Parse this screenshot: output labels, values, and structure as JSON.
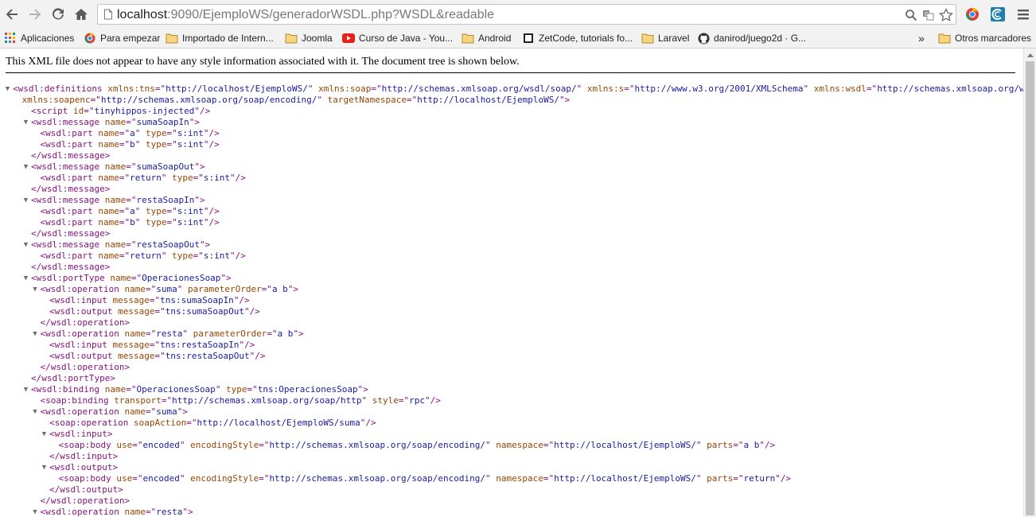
{
  "browser": {
    "url_host": "localhost",
    "url_rest": ":9090/EjemploWS/generadorWSDL.php?WSDL&readable",
    "icons": {
      "back": "back-arrow-icon",
      "forward": "forward-arrow-icon",
      "reload": "reload-icon",
      "home": "home-icon",
      "page": "page-icon",
      "zoom": "magnifier-icon",
      "translate": "translate-icon",
      "star": "bookmark-star-icon",
      "ext1": "chrome-extension-icon",
      "ext2": "extension-icon",
      "menu": "hamburger-menu-icon"
    }
  },
  "bookmarks": {
    "items": [
      {
        "label": "Aplicaciones",
        "icon": "apps-grid-icon"
      },
      {
        "label": "Para empezar",
        "icon": "chrome-logo-icon"
      },
      {
        "label": "Importado de Intern...",
        "icon": "folder-icon"
      },
      {
        "label": "Joomla",
        "icon": "folder-icon"
      },
      {
        "label": "Curso de Java - You...",
        "icon": "youtube-icon"
      },
      {
        "label": "Android",
        "icon": "folder-icon"
      },
      {
        "label": "ZetCode, tutorials fo...",
        "icon": "zetcode-icon"
      },
      {
        "label": "Laravel",
        "icon": "folder-icon"
      },
      {
        "label": "danirod/juego2d · G...",
        "icon": "github-icon"
      }
    ],
    "overflow": "»",
    "other": {
      "label": "Otros marcadores",
      "icon": "folder-icon"
    }
  },
  "content": {
    "notice": "This XML file does not appear to have any style information associated with it. The document tree is shown below.",
    "lines": [
      {
        "t": true,
        "parts": [
          [
            "tag",
            "<wsdl:definitions "
          ],
          [
            "an",
            "xmlns:tns"
          ],
          [
            "tag",
            "=\""
          ],
          [
            "av",
            "http://localhost/EjemploWS/"
          ],
          [
            "tag",
            "\" "
          ],
          [
            "an",
            "xmlns:soap"
          ],
          [
            "tag",
            "=\""
          ],
          [
            "av",
            "http://schemas.xmlsoap.org/wsdl/soap/"
          ],
          [
            "tag",
            "\" "
          ],
          [
            "an",
            "xmlns:s"
          ],
          [
            "tag",
            "=\""
          ],
          [
            "av",
            "http://www.w3.org/2001/XMLSchema"
          ],
          [
            "tag",
            "\" "
          ],
          [
            "an",
            "xmlns:wsdl"
          ],
          [
            "tag",
            "=\""
          ],
          [
            "av",
            "http://schemas.xmlsoap.org/wsdl/"
          ],
          [
            "tag",
            "\""
          ]
        ]
      },
      {
        "d": 1,
        "parts": [
          [
            "an",
            "xmlns:soapenc"
          ],
          [
            "tag",
            "=\""
          ],
          [
            "av",
            "http://schemas.xmlsoap.org/soap/encoding/"
          ],
          [
            "tag",
            "\" "
          ],
          [
            "an",
            "targetNamespace"
          ],
          [
            "tag",
            "=\""
          ],
          [
            "av",
            "http://localhost/EjemploWS/"
          ],
          [
            "tag",
            "\">"
          ]
        ]
      },
      {
        "d": 2,
        "parts": [
          [
            "tag",
            "<script "
          ],
          [
            "an",
            "id"
          ],
          [
            "tag",
            "=\""
          ],
          [
            "av",
            "tinyhippos-injected"
          ],
          [
            "tag",
            "\"/>"
          ]
        ]
      },
      {
        "d": 2,
        "t": true,
        "parts": [
          [
            "tag",
            "<wsdl:message "
          ],
          [
            "an",
            "name"
          ],
          [
            "tag",
            "=\""
          ],
          [
            "av",
            "sumaSoapIn"
          ],
          [
            "tag",
            "\">"
          ]
        ]
      },
      {
        "d": 3,
        "parts": [
          [
            "tag",
            "<wsdl:part "
          ],
          [
            "an",
            "name"
          ],
          [
            "tag",
            "=\""
          ],
          [
            "av",
            "a"
          ],
          [
            "tag",
            "\" "
          ],
          [
            "an",
            "type"
          ],
          [
            "tag",
            "=\""
          ],
          [
            "av",
            "s:int"
          ],
          [
            "tag",
            "\"/>"
          ]
        ]
      },
      {
        "d": 3,
        "parts": [
          [
            "tag",
            "<wsdl:part "
          ],
          [
            "an",
            "name"
          ],
          [
            "tag",
            "=\""
          ],
          [
            "av",
            "b"
          ],
          [
            "tag",
            "\" "
          ],
          [
            "an",
            "type"
          ],
          [
            "tag",
            "=\""
          ],
          [
            "av",
            "s:int"
          ],
          [
            "tag",
            "\"/>"
          ]
        ]
      },
      {
        "d": 2,
        "parts": [
          [
            "tag",
            "</wsdl:message>"
          ]
        ]
      },
      {
        "d": 2,
        "t": true,
        "parts": [
          [
            "tag",
            "<wsdl:message "
          ],
          [
            "an",
            "name"
          ],
          [
            "tag",
            "=\""
          ],
          [
            "av",
            "sumaSoapOut"
          ],
          [
            "tag",
            "\">"
          ]
        ]
      },
      {
        "d": 3,
        "parts": [
          [
            "tag",
            "<wsdl:part "
          ],
          [
            "an",
            "name"
          ],
          [
            "tag",
            "=\""
          ],
          [
            "av",
            "return"
          ],
          [
            "tag",
            "\" "
          ],
          [
            "an",
            "type"
          ],
          [
            "tag",
            "=\""
          ],
          [
            "av",
            "s:int"
          ],
          [
            "tag",
            "\"/>"
          ]
        ]
      },
      {
        "d": 2,
        "parts": [
          [
            "tag",
            "</wsdl:message>"
          ]
        ]
      },
      {
        "d": 2,
        "t": true,
        "parts": [
          [
            "tag",
            "<wsdl:message "
          ],
          [
            "an",
            "name"
          ],
          [
            "tag",
            "=\""
          ],
          [
            "av",
            "restaSoapIn"
          ],
          [
            "tag",
            "\">"
          ]
        ]
      },
      {
        "d": 3,
        "parts": [
          [
            "tag",
            "<wsdl:part "
          ],
          [
            "an",
            "name"
          ],
          [
            "tag",
            "=\""
          ],
          [
            "av",
            "a"
          ],
          [
            "tag",
            "\" "
          ],
          [
            "an",
            "type"
          ],
          [
            "tag",
            "=\""
          ],
          [
            "av",
            "s:int"
          ],
          [
            "tag",
            "\"/>"
          ]
        ]
      },
      {
        "d": 3,
        "parts": [
          [
            "tag",
            "<wsdl:part "
          ],
          [
            "an",
            "name"
          ],
          [
            "tag",
            "=\""
          ],
          [
            "av",
            "b"
          ],
          [
            "tag",
            "\" "
          ],
          [
            "an",
            "type"
          ],
          [
            "tag",
            "=\""
          ],
          [
            "av",
            "s:int"
          ],
          [
            "tag",
            "\"/>"
          ]
        ]
      },
      {
        "d": 2,
        "parts": [
          [
            "tag",
            "</wsdl:message>"
          ]
        ]
      },
      {
        "d": 2,
        "t": true,
        "parts": [
          [
            "tag",
            "<wsdl:message "
          ],
          [
            "an",
            "name"
          ],
          [
            "tag",
            "=\""
          ],
          [
            "av",
            "restaSoapOut"
          ],
          [
            "tag",
            "\">"
          ]
        ]
      },
      {
        "d": 3,
        "parts": [
          [
            "tag",
            "<wsdl:part "
          ],
          [
            "an",
            "name"
          ],
          [
            "tag",
            "=\""
          ],
          [
            "av",
            "return"
          ],
          [
            "tag",
            "\" "
          ],
          [
            "an",
            "type"
          ],
          [
            "tag",
            "=\""
          ],
          [
            "av",
            "s:int"
          ],
          [
            "tag",
            "\"/>"
          ]
        ]
      },
      {
        "d": 2,
        "parts": [
          [
            "tag",
            "</wsdl:message>"
          ]
        ]
      },
      {
        "d": 2,
        "t": true,
        "parts": [
          [
            "tag",
            "<wsdl:portType "
          ],
          [
            "an",
            "name"
          ],
          [
            "tag",
            "=\""
          ],
          [
            "av",
            "OperacionesSoap"
          ],
          [
            "tag",
            "\">"
          ]
        ]
      },
      {
        "d": 3,
        "t": true,
        "parts": [
          [
            "tag",
            "<wsdl:operation "
          ],
          [
            "an",
            "name"
          ],
          [
            "tag",
            "=\""
          ],
          [
            "av",
            "suma"
          ],
          [
            "tag",
            "\" "
          ],
          [
            "an",
            "parameterOrder"
          ],
          [
            "tag",
            "=\""
          ],
          [
            "av",
            "a b"
          ],
          [
            "tag",
            "\">"
          ]
        ]
      },
      {
        "d": 4,
        "parts": [
          [
            "tag",
            "<wsdl:input "
          ],
          [
            "an",
            "message"
          ],
          [
            "tag",
            "=\""
          ],
          [
            "av",
            "tns:sumaSoapIn"
          ],
          [
            "tag",
            "\"/>"
          ]
        ]
      },
      {
        "d": 4,
        "parts": [
          [
            "tag",
            "<wsdl:output "
          ],
          [
            "an",
            "message"
          ],
          [
            "tag",
            "=\""
          ],
          [
            "av",
            "tns:sumaSoapOut"
          ],
          [
            "tag",
            "\"/>"
          ]
        ]
      },
      {
        "d": 3,
        "parts": [
          [
            "tag",
            "</wsdl:operation>"
          ]
        ]
      },
      {
        "d": 3,
        "t": true,
        "parts": [
          [
            "tag",
            "<wsdl:operation "
          ],
          [
            "an",
            "name"
          ],
          [
            "tag",
            "=\""
          ],
          [
            "av",
            "resta"
          ],
          [
            "tag",
            "\" "
          ],
          [
            "an",
            "parameterOrder"
          ],
          [
            "tag",
            "=\""
          ],
          [
            "av",
            "a b"
          ],
          [
            "tag",
            "\">"
          ]
        ]
      },
      {
        "d": 4,
        "parts": [
          [
            "tag",
            "<wsdl:input "
          ],
          [
            "an",
            "message"
          ],
          [
            "tag",
            "=\""
          ],
          [
            "av",
            "tns:restaSoapIn"
          ],
          [
            "tag",
            "\"/>"
          ]
        ]
      },
      {
        "d": 4,
        "parts": [
          [
            "tag",
            "<wsdl:output "
          ],
          [
            "an",
            "message"
          ],
          [
            "tag",
            "=\""
          ],
          [
            "av",
            "tns:restaSoapOut"
          ],
          [
            "tag",
            "\"/>"
          ]
        ]
      },
      {
        "d": 3,
        "parts": [
          [
            "tag",
            "</wsdl:operation>"
          ]
        ]
      },
      {
        "d": 2,
        "parts": [
          [
            "tag",
            "</wsdl:portType>"
          ]
        ]
      },
      {
        "d": 2,
        "t": true,
        "parts": [
          [
            "tag",
            "<wsdl:binding "
          ],
          [
            "an",
            "name"
          ],
          [
            "tag",
            "=\""
          ],
          [
            "av",
            "OperacionesSoap"
          ],
          [
            "tag",
            "\" "
          ],
          [
            "an",
            "type"
          ],
          [
            "tag",
            "=\""
          ],
          [
            "av",
            "tns:OperacionesSoap"
          ],
          [
            "tag",
            "\">"
          ]
        ]
      },
      {
        "d": 3,
        "parts": [
          [
            "tag",
            "<soap:binding "
          ],
          [
            "an",
            "transport"
          ],
          [
            "tag",
            "=\""
          ],
          [
            "av",
            "http://schemas.xmlsoap.org/soap/http"
          ],
          [
            "tag",
            "\" "
          ],
          [
            "an",
            "style"
          ],
          [
            "tag",
            "=\""
          ],
          [
            "av",
            "rpc"
          ],
          [
            "tag",
            "\"/>"
          ]
        ]
      },
      {
        "d": 3,
        "t": true,
        "parts": [
          [
            "tag",
            "<wsdl:operation "
          ],
          [
            "an",
            "name"
          ],
          [
            "tag",
            "=\""
          ],
          [
            "av",
            "suma"
          ],
          [
            "tag",
            "\">"
          ]
        ]
      },
      {
        "d": 4,
        "parts": [
          [
            "tag",
            "<soap:operation "
          ],
          [
            "an",
            "soapAction"
          ],
          [
            "tag",
            "=\""
          ],
          [
            "av",
            "http://localhost/EjemploWS/suma"
          ],
          [
            "tag",
            "\"/>"
          ]
        ]
      },
      {
        "d": 4,
        "t": true,
        "parts": [
          [
            "tag",
            "<wsdl:input>"
          ]
        ]
      },
      {
        "d": 5,
        "parts": [
          [
            "tag",
            "<soap:body "
          ],
          [
            "an",
            "use"
          ],
          [
            "tag",
            "=\""
          ],
          [
            "av",
            "encoded"
          ],
          [
            "tag",
            "\" "
          ],
          [
            "an",
            "encodingStyle"
          ],
          [
            "tag",
            "=\""
          ],
          [
            "av",
            "http://schemas.xmlsoap.org/soap/encoding/"
          ],
          [
            "tag",
            "\" "
          ],
          [
            "an",
            "namespace"
          ],
          [
            "tag",
            "=\""
          ],
          [
            "av",
            "http://localhost/EjemploWS/"
          ],
          [
            "tag",
            "\" "
          ],
          [
            "an",
            "parts"
          ],
          [
            "tag",
            "=\""
          ],
          [
            "av",
            "a b"
          ],
          [
            "tag",
            "\"/>"
          ]
        ]
      },
      {
        "d": 4,
        "parts": [
          [
            "tag",
            "</wsdl:input>"
          ]
        ]
      },
      {
        "d": 4,
        "t": true,
        "parts": [
          [
            "tag",
            "<wsdl:output>"
          ]
        ]
      },
      {
        "d": 5,
        "parts": [
          [
            "tag",
            "<soap:body "
          ],
          [
            "an",
            "use"
          ],
          [
            "tag",
            "=\""
          ],
          [
            "av",
            "encoded"
          ],
          [
            "tag",
            "\" "
          ],
          [
            "an",
            "encodingStyle"
          ],
          [
            "tag",
            "=\""
          ],
          [
            "av",
            "http://schemas.xmlsoap.org/soap/encoding/"
          ],
          [
            "tag",
            "\" "
          ],
          [
            "an",
            "namespace"
          ],
          [
            "tag",
            "=\""
          ],
          [
            "av",
            "http://localhost/EjemploWS/"
          ],
          [
            "tag",
            "\" "
          ],
          [
            "an",
            "parts"
          ],
          [
            "tag",
            "=\""
          ],
          [
            "av",
            "return"
          ],
          [
            "tag",
            "\"/>"
          ]
        ]
      },
      {
        "d": 4,
        "parts": [
          [
            "tag",
            "</wsdl:output>"
          ]
        ]
      },
      {
        "d": 3,
        "parts": [
          [
            "tag",
            "</wsdl:operation>"
          ]
        ]
      },
      {
        "d": 3,
        "t": true,
        "parts": [
          [
            "tag",
            "<wsdl:operation "
          ],
          [
            "an",
            "name"
          ],
          [
            "tag",
            "=\""
          ],
          [
            "av",
            "resta"
          ],
          [
            "tag",
            "\">"
          ]
        ]
      }
    ]
  },
  "colors": {
    "tag": "#881280",
    "attr_name": "#994500",
    "attr_value": "#1a1aa6",
    "toolbar_bg": "#f2f2f2"
  }
}
